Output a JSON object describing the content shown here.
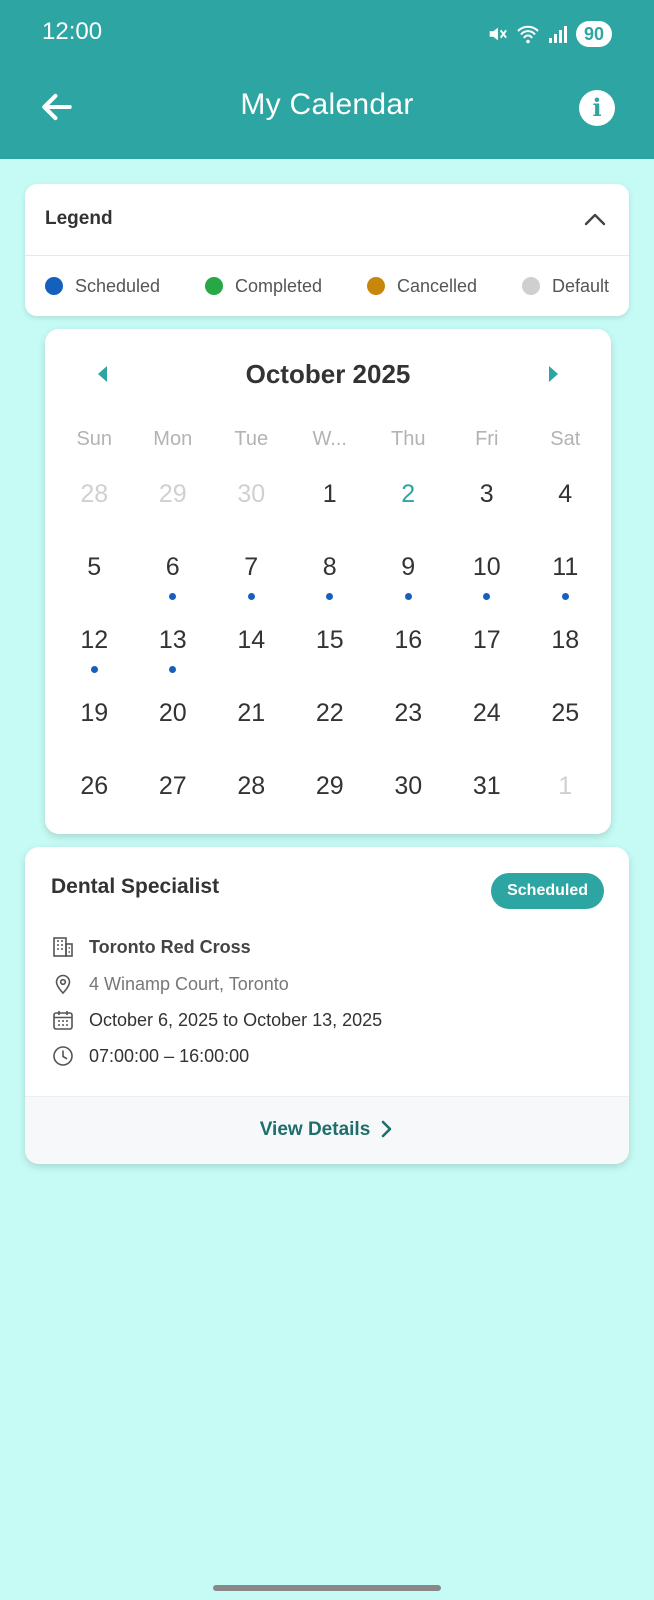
{
  "status_bar": {
    "time": "12:00",
    "battery": "90"
  },
  "header": {
    "title": "My Calendar",
    "back_icon": "arrow-left-icon",
    "info_icon": "info-icon"
  },
  "legend": {
    "title": "Legend",
    "items": [
      {
        "label": "Scheduled",
        "color": "#1560bd"
      },
      {
        "label": "Completed",
        "color": "#28a745"
      },
      {
        "label": "Cancelled",
        "color": "#c8860a"
      },
      {
        "label": "Default",
        "color": "#cfcfcf"
      }
    ]
  },
  "calendar": {
    "month_label": "October 2025",
    "weekdays": [
      "Sun",
      "Mon",
      "Tue",
      "W...",
      "Thu",
      "Fri",
      "Sat"
    ],
    "weeks": [
      [
        {
          "d": "28",
          "muted": true
        },
        {
          "d": "29",
          "muted": true
        },
        {
          "d": "30",
          "muted": true
        },
        {
          "d": "1"
        },
        {
          "d": "2",
          "today": true
        },
        {
          "d": "3"
        },
        {
          "d": "4"
        }
      ],
      [
        {
          "d": "5"
        },
        {
          "d": "6",
          "event": true
        },
        {
          "d": "7",
          "event": true
        },
        {
          "d": "8",
          "event": true
        },
        {
          "d": "9",
          "event": true
        },
        {
          "d": "10",
          "event": true
        },
        {
          "d": "11",
          "event": true
        }
      ],
      [
        {
          "d": "12",
          "event": true
        },
        {
          "d": "13",
          "event": true
        },
        {
          "d": "14"
        },
        {
          "d": "15"
        },
        {
          "d": "16"
        },
        {
          "d": "17"
        },
        {
          "d": "18"
        }
      ],
      [
        {
          "d": "19"
        },
        {
          "d": "20"
        },
        {
          "d": "21"
        },
        {
          "d": "22"
        },
        {
          "d": "23"
        },
        {
          "d": "24"
        },
        {
          "d": "25"
        }
      ],
      [
        {
          "d": "26"
        },
        {
          "d": "27"
        },
        {
          "d": "28"
        },
        {
          "d": "29"
        },
        {
          "d": "30"
        },
        {
          "d": "31"
        },
        {
          "d": "1",
          "muted": true
        }
      ]
    ]
  },
  "event": {
    "title": "Dental Specialist",
    "status": "Scheduled",
    "location_name": "Toronto Red Cross",
    "address": "4 Winamp Court, Toronto",
    "dates": "October 6, 2025 to October 13, 2025",
    "time": "07:00:00 – 16:00:00",
    "action": "View Details"
  },
  "colors": {
    "primary": "#2da6a3",
    "background": "#c6fbf5",
    "event_dot": "#1560bd"
  }
}
